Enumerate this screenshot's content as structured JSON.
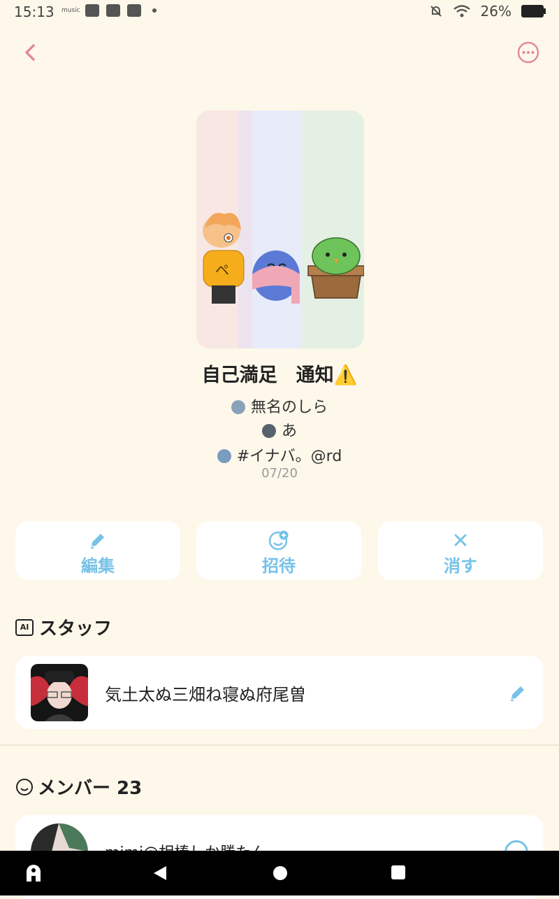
{
  "status": {
    "time": "15:13",
    "music": "music",
    "battery": "26%"
  },
  "room": {
    "title": "自己満足　通知⚠️",
    "creators": [
      "無名のしら",
      "あ",
      "#イナバ。@rd"
    ],
    "date": "07/20"
  },
  "actions": {
    "edit": "編集",
    "invite": "招待",
    "delete": "消す"
  },
  "staff": {
    "heading": "スタッフ",
    "badge": "AI",
    "name": "気土太ぬ三畑ね寝ぬ府尾曽"
  },
  "members": {
    "heading": "メンバー 23",
    "first_name": "mimi@相棒しか勝たん"
  },
  "colors": {
    "accent": "#76c2e8",
    "back_pink": "#e38a99",
    "background": "#fdf8ea"
  }
}
